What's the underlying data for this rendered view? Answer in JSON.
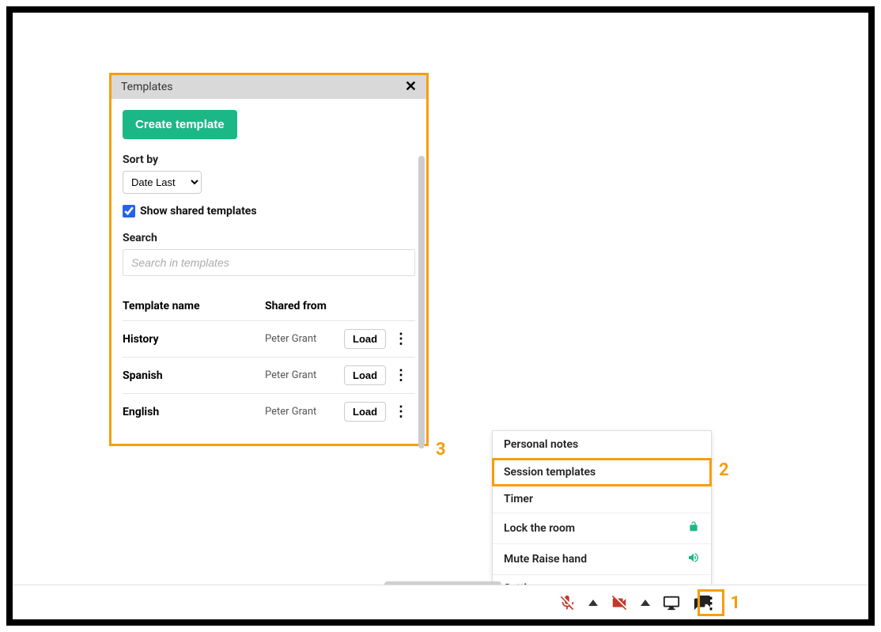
{
  "panel": {
    "title": "Templates",
    "create_label": "Create template",
    "sort_label": "Sort by",
    "sort_value": "Date Last",
    "show_shared_label": "Show shared templates",
    "search_label": "Search",
    "search_placeholder": "Search in templates",
    "columns": {
      "name": "Template name",
      "from": "Shared from"
    },
    "load_label": "Load",
    "rows": [
      {
        "name": "History",
        "from": "Peter Grant"
      },
      {
        "name": "Spanish",
        "from": "Peter Grant"
      },
      {
        "name": "English",
        "from": "Peter Grant"
      }
    ]
  },
  "menu": {
    "items": [
      {
        "label": "Personal notes"
      },
      {
        "label": "Session templates"
      },
      {
        "label": "Timer"
      },
      {
        "label": "Lock the room",
        "icon": "unlock"
      },
      {
        "label": "Mute Raise hand",
        "icon": "volume"
      },
      {
        "label": "Settings"
      }
    ]
  },
  "callouts": {
    "c1": "1",
    "c2": "2",
    "c3": "3"
  }
}
